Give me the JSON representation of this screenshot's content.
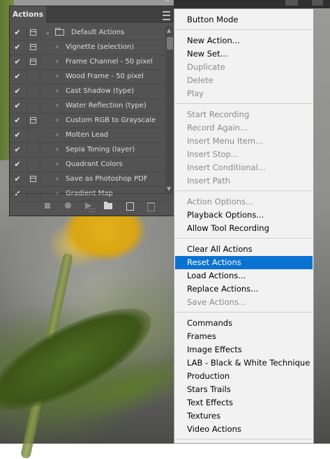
{
  "panel": {
    "tab_label": "Actions",
    "close_glyph": "×",
    "collapse_glyph": "»",
    "rows": [
      {
        "label": "Default Actions",
        "checked": true,
        "dialog": true,
        "folder": true,
        "expanded": true
      },
      {
        "label": "Vignette (selection)",
        "checked": true,
        "dialog": true
      },
      {
        "label": "Frame Channel - 50 pixel",
        "checked": true,
        "dialog": true
      },
      {
        "label": "Wood Frame - 50 pixel",
        "checked": true,
        "dialog": false
      },
      {
        "label": "Cast Shadow (type)",
        "checked": true,
        "dialog": false
      },
      {
        "label": "Water Reflection (type)",
        "checked": true,
        "dialog": false
      },
      {
        "label": "Custom RGB to Grayscale",
        "checked": true,
        "dialog": true
      },
      {
        "label": "Molten Lead",
        "checked": true,
        "dialog": false
      },
      {
        "label": "Sepia Toning (layer)",
        "checked": true,
        "dialog": false
      },
      {
        "label": "Quadrant Colors",
        "checked": true,
        "dialog": false
      },
      {
        "label": "Save as Photoshop PDF",
        "checked": true,
        "dialog": true
      },
      {
        "label": "Gradient Map",
        "checked": true,
        "dialog": false
      }
    ],
    "check_glyph": "✔",
    "arrow_right": "›",
    "arrow_down": "⌄"
  },
  "menu": {
    "items": [
      {
        "label": "Button Mode",
        "state": "enabled"
      },
      {
        "sep": true
      },
      {
        "label": "New Action...",
        "state": "enabled"
      },
      {
        "label": "New Set...",
        "state": "enabled"
      },
      {
        "label": "Duplicate",
        "state": "disabled"
      },
      {
        "label": "Delete",
        "state": "disabled"
      },
      {
        "label": "Play",
        "state": "disabled"
      },
      {
        "sep": true
      },
      {
        "label": "Start Recording",
        "state": "disabled"
      },
      {
        "label": "Record Again...",
        "state": "disabled"
      },
      {
        "label": "Insert Menu Item...",
        "state": "disabled"
      },
      {
        "label": "Insert Stop...",
        "state": "disabled"
      },
      {
        "label": "Insert Conditional...",
        "state": "disabled"
      },
      {
        "label": "Insert Path",
        "state": "disabled"
      },
      {
        "sep": true
      },
      {
        "label": "Action Options...",
        "state": "disabled"
      },
      {
        "label": "Playback Options...",
        "state": "enabled"
      },
      {
        "label": "Allow Tool Recording",
        "state": "enabled"
      },
      {
        "sep": true
      },
      {
        "label": "Clear All Actions",
        "state": "enabled"
      },
      {
        "label": "Reset Actions",
        "state": "selected"
      },
      {
        "label": "Load Actions...",
        "state": "enabled"
      },
      {
        "label": "Replace Actions...",
        "state": "enabled"
      },
      {
        "label": "Save Actions...",
        "state": "disabled"
      },
      {
        "sep": true
      },
      {
        "label": "Commands",
        "state": "enabled"
      },
      {
        "label": "Frames",
        "state": "enabled"
      },
      {
        "label": "Image Effects",
        "state": "enabled"
      },
      {
        "label": "LAB - Black & White Technique",
        "state": "enabled"
      },
      {
        "label": "Production",
        "state": "enabled"
      },
      {
        "label": "Stars Trails",
        "state": "enabled"
      },
      {
        "label": "Text Effects",
        "state": "enabled"
      },
      {
        "label": "Textures",
        "state": "enabled"
      },
      {
        "label": "Video Actions",
        "state": "enabled"
      },
      {
        "sep": true
      }
    ]
  },
  "colors": {
    "selected_bg": "#0a72d1",
    "panel_bg": "#535353",
    "menu_bg": "#f2f2f2"
  }
}
